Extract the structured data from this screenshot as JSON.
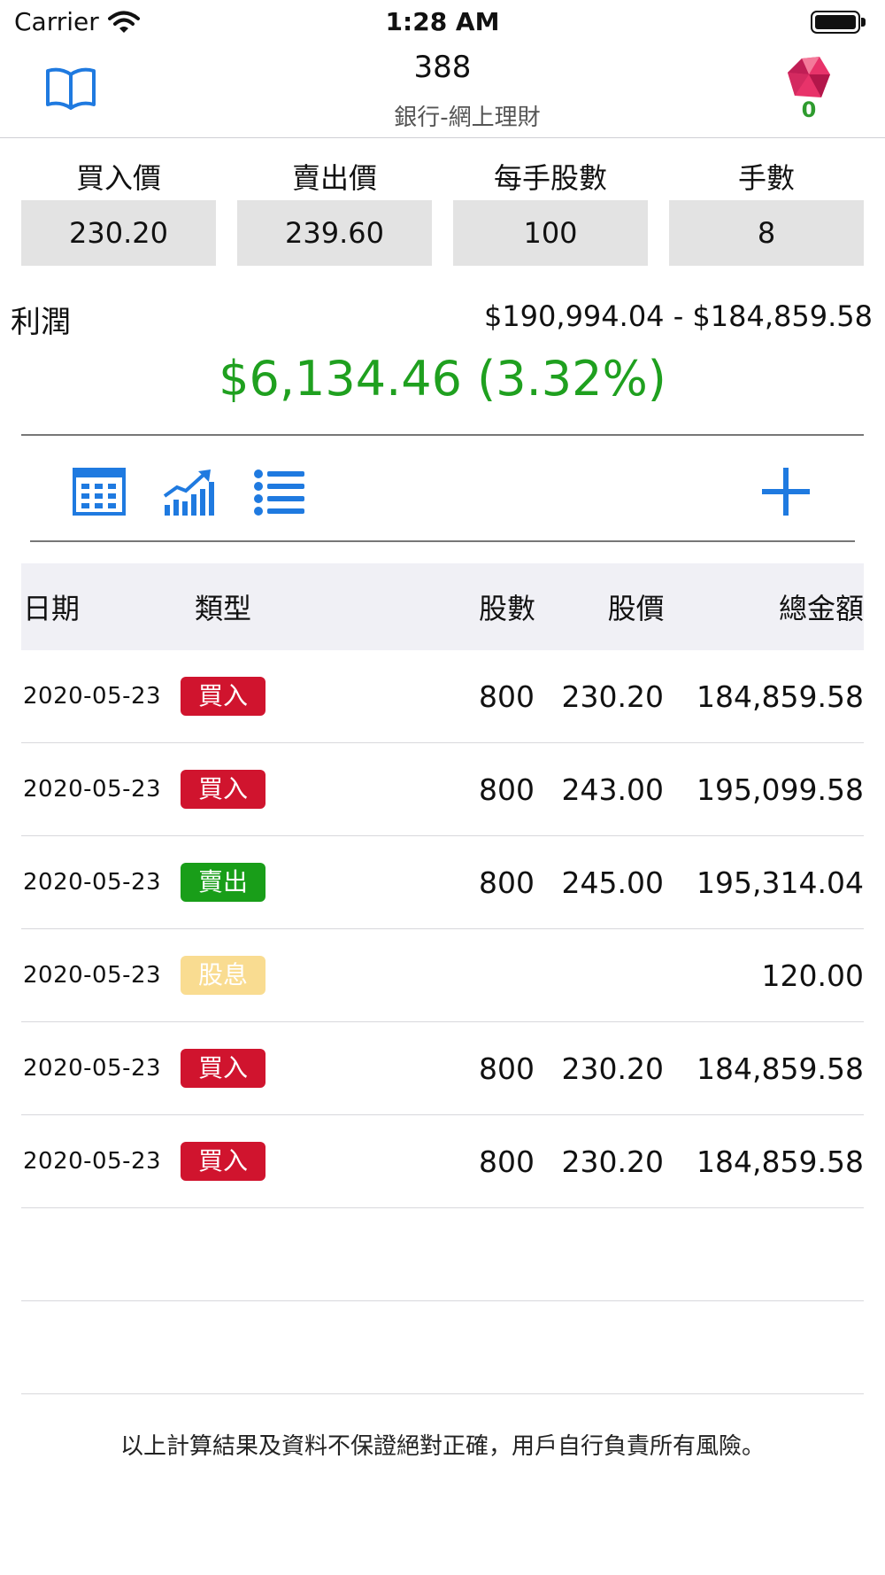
{
  "status_bar": {
    "carrier": "Carrier",
    "time": "1:28 AM"
  },
  "nav": {
    "title": "388",
    "subtitle": "銀行-網上理財",
    "gem_count": "0"
  },
  "fields": [
    {
      "label": "買入價",
      "value": "230.20"
    },
    {
      "label": "賣出價",
      "value": "239.60"
    },
    {
      "label": "每手股數",
      "value": "100"
    },
    {
      "label": "手數",
      "value": "8"
    }
  ],
  "profit": {
    "label": "利潤",
    "range": "$190,994.04 - $184,859.58",
    "value": "$6,134.46 (3.32%)"
  },
  "toolbar": {
    "icons": [
      "table-icon",
      "chart-icon",
      "list-icon",
      "plus-icon"
    ]
  },
  "table": {
    "headers": {
      "date": "日期",
      "type": "類型",
      "shares": "股數",
      "price": "股價",
      "total": "總金額"
    },
    "rows": [
      {
        "date": "2020-05-23",
        "type": "買入",
        "kind": "buy",
        "shares": "800",
        "price": "230.20",
        "total": "184,859.58"
      },
      {
        "date": "2020-05-23",
        "type": "買入",
        "kind": "buy",
        "shares": "800",
        "price": "243.00",
        "total": "195,099.58"
      },
      {
        "date": "2020-05-23",
        "type": "賣出",
        "kind": "sell",
        "shares": "800",
        "price": "245.00",
        "total": "195,314.04"
      },
      {
        "date": "2020-05-23",
        "type": "股息",
        "kind": "div",
        "shares": "",
        "price": "",
        "total": "120.00"
      },
      {
        "date": "2020-05-23",
        "type": "買入",
        "kind": "buy",
        "shares": "800",
        "price": "230.20",
        "total": "184,859.58"
      },
      {
        "date": "2020-05-23",
        "type": "買入",
        "kind": "buy",
        "shares": "800",
        "price": "230.20",
        "total": "184,859.58"
      }
    ]
  },
  "disclaimer": "以上計算結果及資料不保證絕對正確，用戶自行負責所有風險。",
  "colors": {
    "accent": "#1f7ae0",
    "profit": "#1fa01f",
    "buy": "#d0142e",
    "sell": "#199e19",
    "dividend": "#f9dc91"
  }
}
